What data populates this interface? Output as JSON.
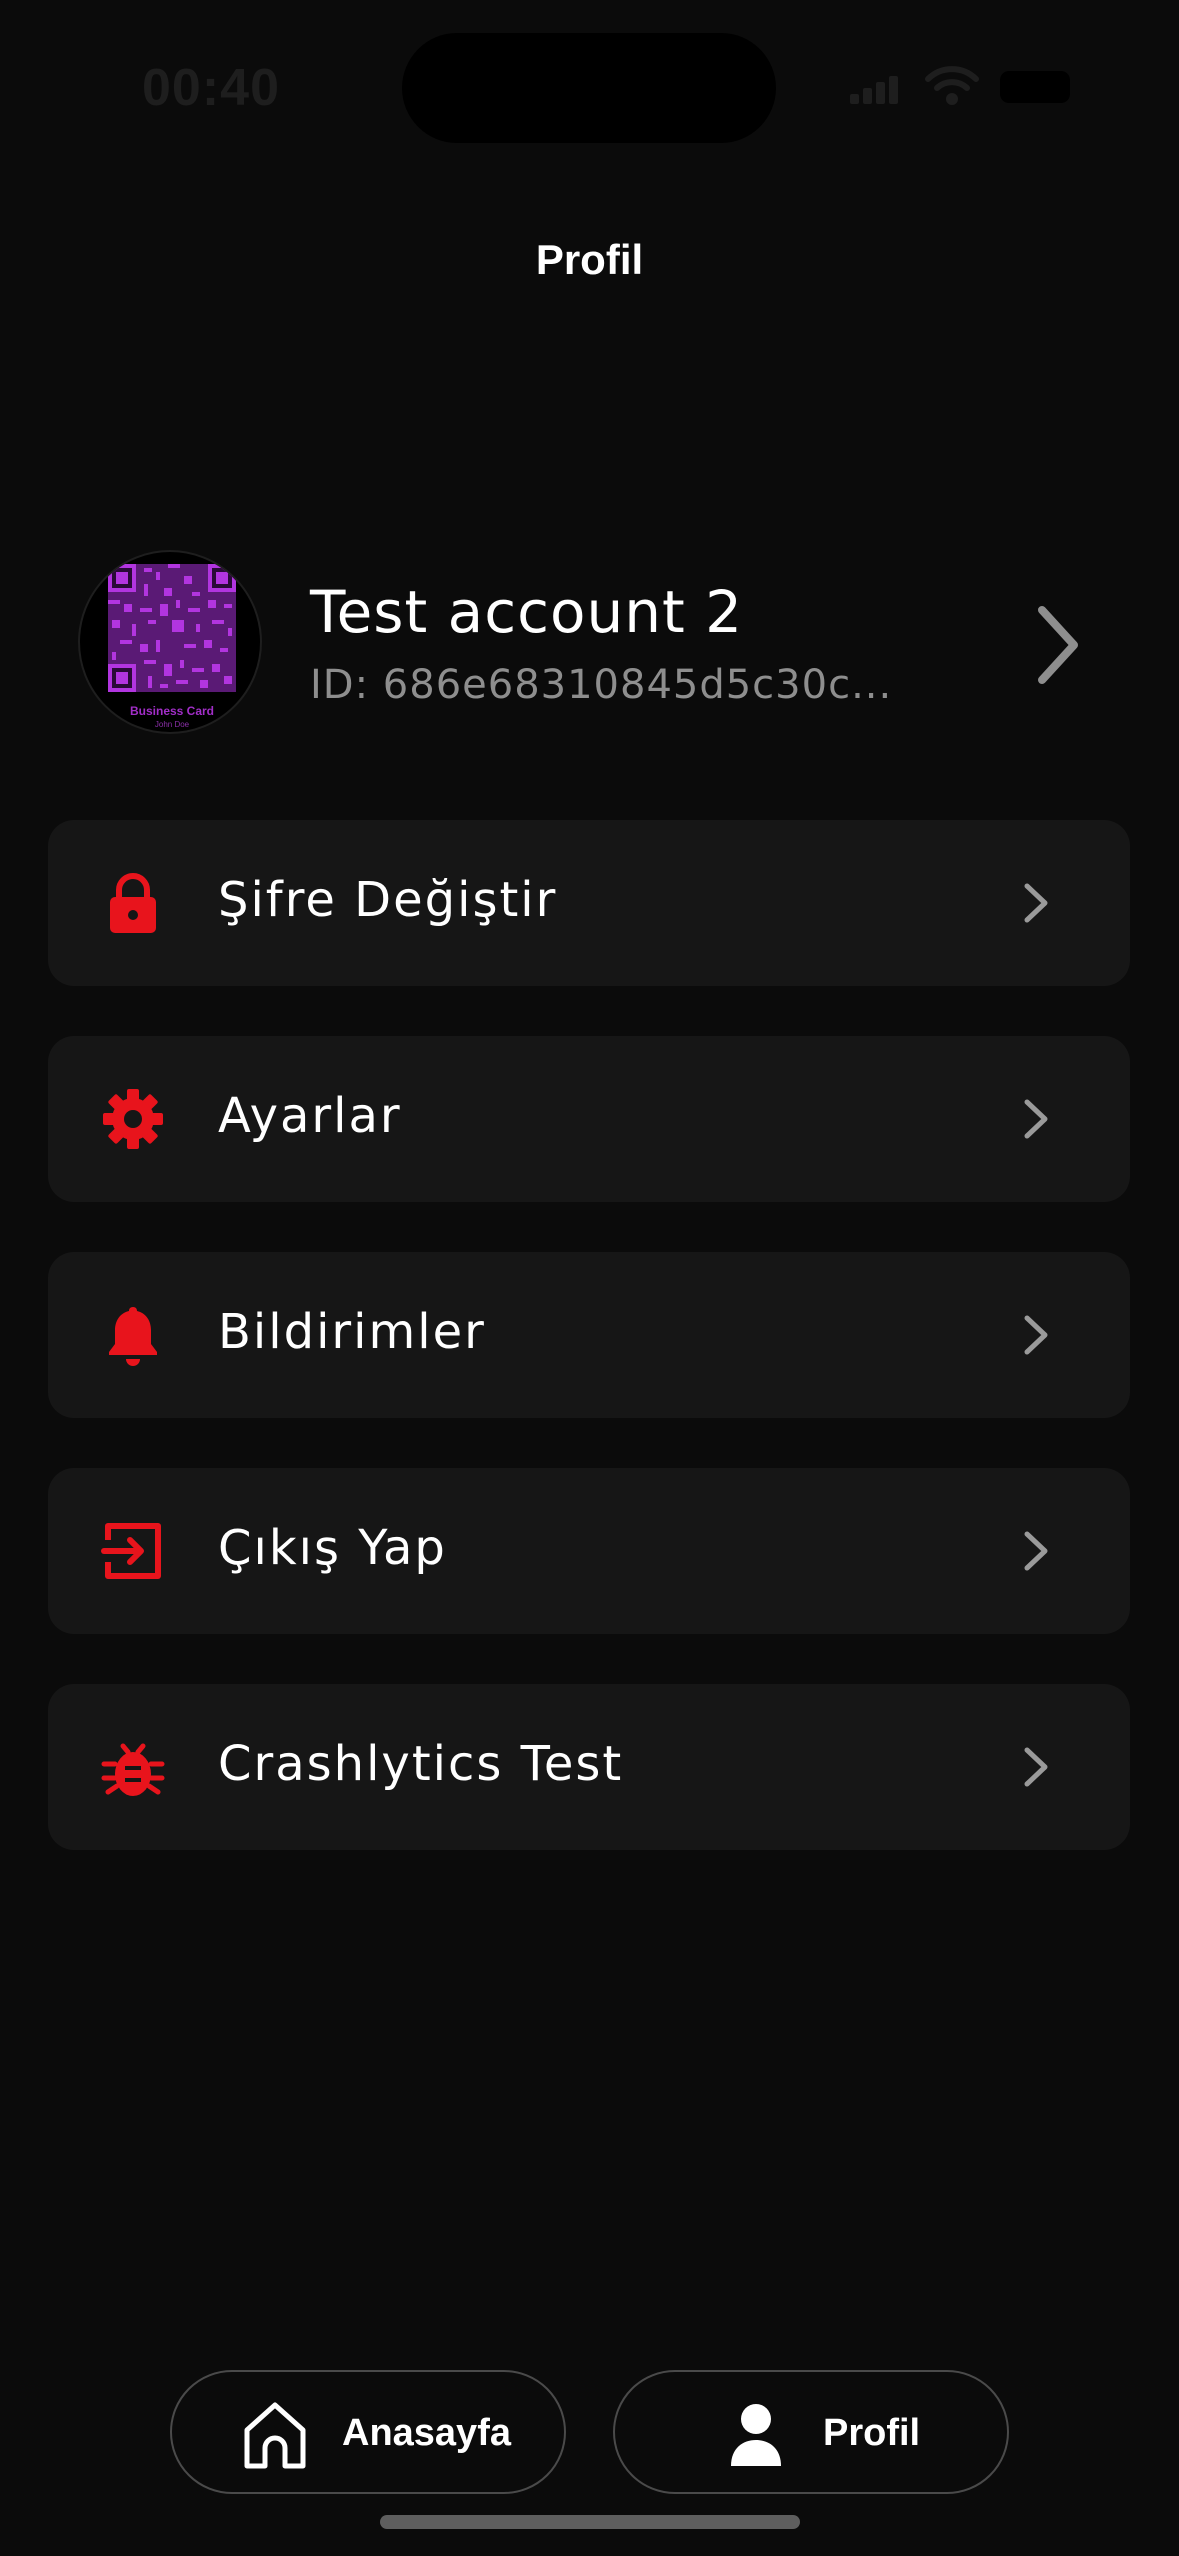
{
  "status_bar": {
    "time": "00:40"
  },
  "header": {
    "title": "Profil"
  },
  "profile": {
    "name": "Test account 2",
    "id_text": "ID: 686e68310845d5c30c...",
    "avatar_card_label": "Business Card",
    "avatar_card_sub": "John Doe"
  },
  "menu": {
    "items": [
      {
        "label": "Şifre Değiştir",
        "icon": "lock-icon"
      },
      {
        "label": "Ayarlar",
        "icon": "gear-icon"
      },
      {
        "label": "Bildirimler",
        "icon": "bell-icon"
      },
      {
        "label": "Çıkış Yap",
        "icon": "logout-icon"
      },
      {
        "label": "Crashlytics Test",
        "icon": "bug-icon"
      }
    ]
  },
  "bottom_nav": {
    "items": [
      {
        "label": "Anasayfa",
        "icon": "home-icon"
      },
      {
        "label": "Profil",
        "icon": "person-icon",
        "selected": true
      }
    ]
  },
  "colors": {
    "background": "#0b0b0b",
    "card": "#161616",
    "accent": "#e8141c",
    "qr": "#a22ec8",
    "muted_text": "#8e8e8e"
  }
}
